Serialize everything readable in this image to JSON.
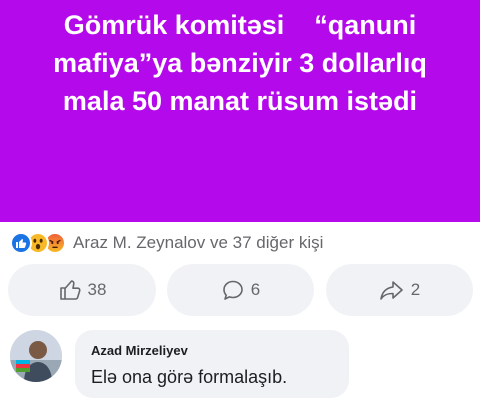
{
  "post": {
    "title_lines": [
      "Gömrük komitəsi    “qanuni",
      "mafiya”ya bənziyir 3 dollarlıq",
      "mala 50 manat rüsum istədi"
    ],
    "background_color": "#b40aeb"
  },
  "reactions": {
    "icons": [
      "like-icon",
      "wow-icon",
      "angry-icon"
    ],
    "summary": "Araz M. Zeynalov ve 37 diğer kişi"
  },
  "actions": {
    "like_count": "38",
    "comment_count": "6",
    "share_count": "2"
  },
  "comment": {
    "author": "Azad Mirzeliyev",
    "text": "Elə ona görə formalaşıb."
  }
}
